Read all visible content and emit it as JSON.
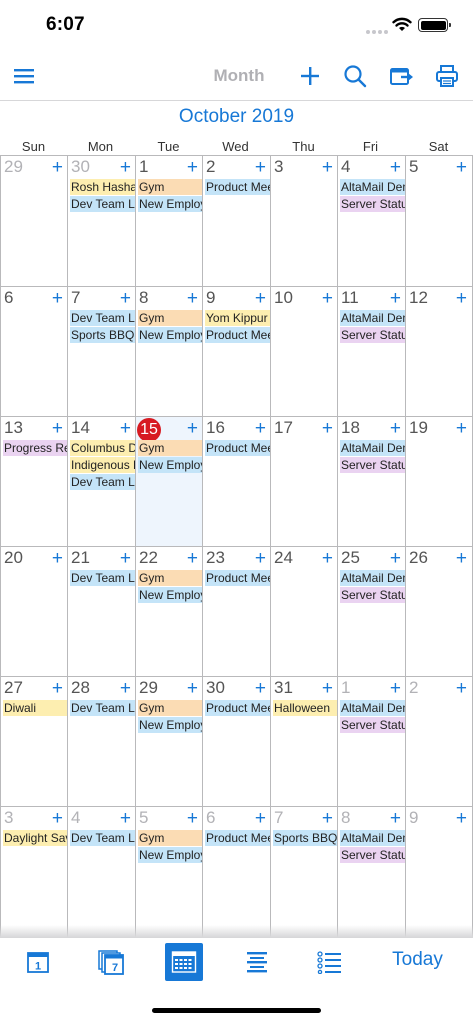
{
  "status": {
    "time": "6:07"
  },
  "toolbar": {
    "view_title": "Month"
  },
  "calendar": {
    "month_title": "October 2019",
    "weekdays": [
      "Sun",
      "Mon",
      "Tue",
      "Wed",
      "Thu",
      "Fri",
      "Sat"
    ],
    "today_day": "15",
    "weeks": [
      [
        {
          "day": "29",
          "other": true,
          "events": []
        },
        {
          "day": "30",
          "other": true,
          "events": [
            {
              "t": "Rosh Hashana",
              "c": "yellow"
            },
            {
              "t": "Dev Team Lunch",
              "c": "blue"
            }
          ]
        },
        {
          "day": "1",
          "events": [
            {
              "t": "Gym",
              "c": "orange"
            },
            {
              "t": "New Employee",
              "c": "blue"
            }
          ]
        },
        {
          "day": "2",
          "events": [
            {
              "t": "Product Meeting",
              "c": "blue"
            }
          ]
        },
        {
          "day": "3",
          "events": []
        },
        {
          "day": "4",
          "events": [
            {
              "t": "AltaMail Demo",
              "c": "blue"
            },
            {
              "t": "Server Status",
              "c": "purple"
            }
          ]
        },
        {
          "day": "5",
          "events": []
        }
      ],
      [
        {
          "day": "6",
          "events": []
        },
        {
          "day": "7",
          "events": [
            {
              "t": "Dev Team Lunch",
              "c": "blue"
            },
            {
              "t": "Sports BBQ",
              "c": "blue"
            }
          ]
        },
        {
          "day": "8",
          "events": [
            {
              "t": "Gym",
              "c": "orange"
            },
            {
              "t": "New Employee",
              "c": "blue"
            }
          ]
        },
        {
          "day": "9",
          "events": [
            {
              "t": "Yom Kippur",
              "c": "yellow"
            },
            {
              "t": "Product Meeting",
              "c": "blue"
            }
          ]
        },
        {
          "day": "10",
          "events": []
        },
        {
          "day": "11",
          "events": [
            {
              "t": "AltaMail Demo",
              "c": "blue"
            },
            {
              "t": "Server Status",
              "c": "purple"
            }
          ]
        },
        {
          "day": "12",
          "events": []
        }
      ],
      [
        {
          "day": "13",
          "events": [
            {
              "t": "Progress Report",
              "c": "purple"
            }
          ]
        },
        {
          "day": "14",
          "events": [
            {
              "t": "Columbus Day",
              "c": "yellow"
            },
            {
              "t": "Indigenous Peoples",
              "c": "yellow"
            },
            {
              "t": "Dev Team Lunch",
              "c": "blue"
            }
          ]
        },
        {
          "day": "15",
          "today": true,
          "events": [
            {
              "t": "Gym",
              "c": "orange"
            },
            {
              "t": "New Employee",
              "c": "blue"
            }
          ]
        },
        {
          "day": "16",
          "events": [
            {
              "t": "Product Meeting",
              "c": "blue"
            }
          ]
        },
        {
          "day": "17",
          "events": []
        },
        {
          "day": "18",
          "events": [
            {
              "t": "AltaMail Demo",
              "c": "blue"
            },
            {
              "t": "Server Status",
              "c": "purple"
            }
          ]
        },
        {
          "day": "19",
          "events": []
        }
      ],
      [
        {
          "day": "20",
          "events": []
        },
        {
          "day": "21",
          "events": [
            {
              "t": "Dev Team Lunch",
              "c": "blue"
            }
          ]
        },
        {
          "day": "22",
          "events": [
            {
              "t": "Gym",
              "c": "orange"
            },
            {
              "t": "New Employee",
              "c": "blue"
            }
          ]
        },
        {
          "day": "23",
          "events": [
            {
              "t": "Product Meeting",
              "c": "blue"
            }
          ]
        },
        {
          "day": "24",
          "events": []
        },
        {
          "day": "25",
          "events": [
            {
              "t": "AltaMail Demo",
              "c": "blue"
            },
            {
              "t": "Server Status",
              "c": "purple"
            }
          ]
        },
        {
          "day": "26",
          "events": []
        }
      ],
      [
        {
          "day": "27",
          "events": [
            {
              "t": "Diwali",
              "c": "yellow"
            }
          ]
        },
        {
          "day": "28",
          "events": [
            {
              "t": "Dev Team Lunch",
              "c": "blue"
            }
          ]
        },
        {
          "day": "29",
          "events": [
            {
              "t": "Gym",
              "c": "orange"
            },
            {
              "t": "New Employee",
              "c": "blue"
            }
          ]
        },
        {
          "day": "30",
          "events": [
            {
              "t": "Product Meeting",
              "c": "blue"
            }
          ]
        },
        {
          "day": "31",
          "events": [
            {
              "t": "Halloween",
              "c": "yellow"
            }
          ]
        },
        {
          "day": "1",
          "other": true,
          "events": [
            {
              "t": "AltaMail Demo",
              "c": "blue"
            },
            {
              "t": "Server Status",
              "c": "purple"
            }
          ]
        },
        {
          "day": "2",
          "other": true,
          "events": []
        }
      ],
      [
        {
          "day": "3",
          "other": true,
          "events": [
            {
              "t": "Daylight Saving",
              "c": "yellow"
            }
          ]
        },
        {
          "day": "4",
          "other": true,
          "events": [
            {
              "t": "Dev Team Lunch",
              "c": "blue"
            }
          ]
        },
        {
          "day": "5",
          "other": true,
          "events": [
            {
              "t": "Gym",
              "c": "orange"
            },
            {
              "t": "New Employee",
              "c": "blue"
            }
          ]
        },
        {
          "day": "6",
          "other": true,
          "events": [
            {
              "t": "Product Meeting",
              "c": "blue"
            }
          ]
        },
        {
          "day": "7",
          "other": true,
          "events": [
            {
              "t": "Sports BBQ",
              "c": "blue"
            }
          ]
        },
        {
          "day": "8",
          "other": true,
          "events": [
            {
              "t": "AltaMail Demo",
              "c": "blue"
            },
            {
              "t": "Server Status",
              "c": "purple"
            }
          ]
        },
        {
          "day": "9",
          "other": true,
          "events": []
        }
      ]
    ]
  },
  "colors": {
    "accent": "#1778d6",
    "today_badge": "#d71a21",
    "event_blue": "#c4e4f8",
    "event_orange": "#fbdcb4",
    "event_yellow": "#fdeeb0",
    "event_purple": "#ead3f1"
  },
  "tabbar": {
    "items": [
      {
        "name": "day-view-icon",
        "selected": false
      },
      {
        "name": "week-view-icon",
        "selected": false
      },
      {
        "name": "month-view-icon",
        "selected": true
      },
      {
        "name": "agenda-view-icon",
        "selected": false
      },
      {
        "name": "list-view-icon",
        "selected": false
      }
    ],
    "today_label": "Today"
  }
}
